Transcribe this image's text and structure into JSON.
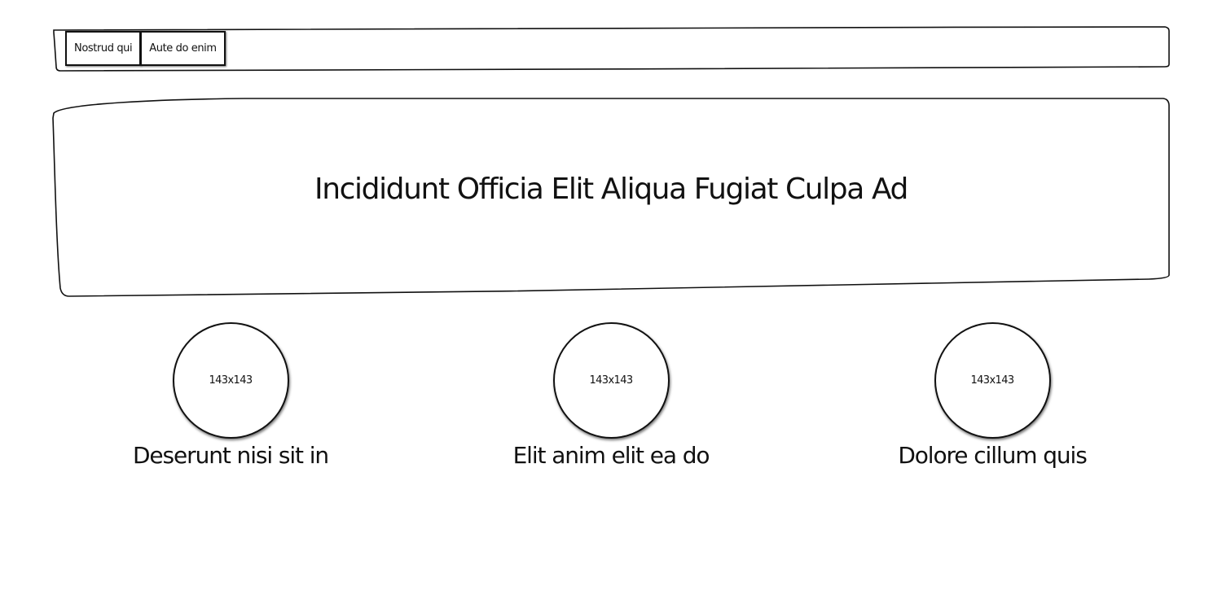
{
  "nav": {
    "items": [
      {
        "label": "Nostrud qui"
      },
      {
        "label": "Aute do enim"
      }
    ]
  },
  "hero": {
    "title": "Incididunt Officia Elit Aliqua Fugiat Culpa Ad"
  },
  "features": [
    {
      "image_label": "143x143",
      "caption": "Deserunt nisi sit in"
    },
    {
      "image_label": "143x143",
      "caption": "Elit anim elit ea do"
    },
    {
      "image_label": "143x143",
      "caption": "Dolore cillum quis"
    }
  ]
}
